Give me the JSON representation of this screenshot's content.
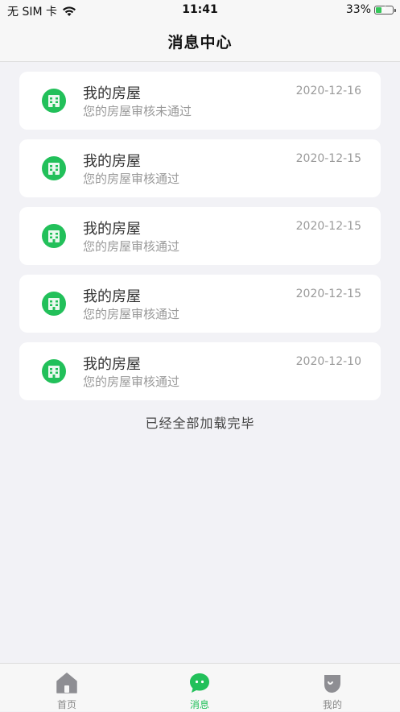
{
  "status_bar": {
    "carrier": "无 SIM 卡",
    "time": "11:41",
    "battery_percent_text": "33%",
    "battery_level": 0.33
  },
  "header": {
    "title": "消息中心"
  },
  "messages": [
    {
      "title": "我的房屋",
      "subtitle": "您的房屋审核未通过",
      "date": "2020-12-16"
    },
    {
      "title": "我的房屋",
      "subtitle": "您的房屋审核通过",
      "date": "2020-12-15"
    },
    {
      "title": "我的房屋",
      "subtitle": "您的房屋审核通过",
      "date": "2020-12-15"
    },
    {
      "title": "我的房屋",
      "subtitle": "您的房屋审核通过",
      "date": "2020-12-15"
    },
    {
      "title": "我的房屋",
      "subtitle": "您的房屋审核通过",
      "date": "2020-12-10"
    }
  ],
  "list_footer": "已经全部加载完毕",
  "tab_bar": {
    "tabs": [
      {
        "label": "首页",
        "icon": "home-icon",
        "active": false
      },
      {
        "label": "消息",
        "icon": "message-icon",
        "active": true
      },
      {
        "label": "我的",
        "icon": "profile-icon",
        "active": false
      }
    ]
  },
  "colors": {
    "accent": "#22c05a",
    "inactive": "#888888",
    "background": "#f2f2f6"
  }
}
